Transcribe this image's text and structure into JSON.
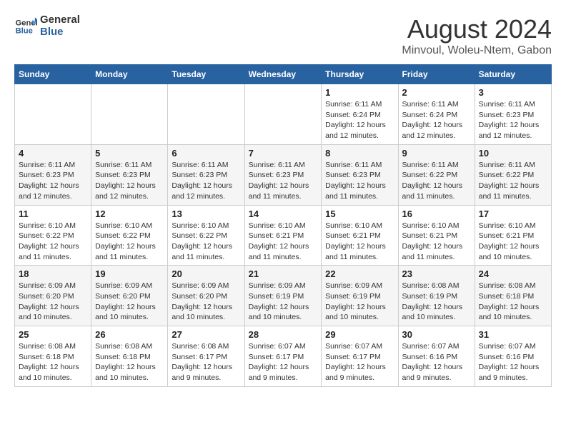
{
  "logo": {
    "line1": "General",
    "line2": "Blue"
  },
  "title": "August 2024",
  "location": "Minvoul, Woleu-Ntem, Gabon",
  "weekdays": [
    "Sunday",
    "Monday",
    "Tuesday",
    "Wednesday",
    "Thursday",
    "Friday",
    "Saturday"
  ],
  "weeks": [
    [
      {
        "day": "",
        "info": ""
      },
      {
        "day": "",
        "info": ""
      },
      {
        "day": "",
        "info": ""
      },
      {
        "day": "",
        "info": ""
      },
      {
        "day": "1",
        "info": "Sunrise: 6:11 AM\nSunset: 6:24 PM\nDaylight: 12 hours\nand 12 minutes."
      },
      {
        "day": "2",
        "info": "Sunrise: 6:11 AM\nSunset: 6:24 PM\nDaylight: 12 hours\nand 12 minutes."
      },
      {
        "day": "3",
        "info": "Sunrise: 6:11 AM\nSunset: 6:23 PM\nDaylight: 12 hours\nand 12 minutes."
      }
    ],
    [
      {
        "day": "4",
        "info": "Sunrise: 6:11 AM\nSunset: 6:23 PM\nDaylight: 12 hours\nand 12 minutes."
      },
      {
        "day": "5",
        "info": "Sunrise: 6:11 AM\nSunset: 6:23 PM\nDaylight: 12 hours\nand 12 minutes."
      },
      {
        "day": "6",
        "info": "Sunrise: 6:11 AM\nSunset: 6:23 PM\nDaylight: 12 hours\nand 12 minutes."
      },
      {
        "day": "7",
        "info": "Sunrise: 6:11 AM\nSunset: 6:23 PM\nDaylight: 12 hours\nand 11 minutes."
      },
      {
        "day": "8",
        "info": "Sunrise: 6:11 AM\nSunset: 6:23 PM\nDaylight: 12 hours\nand 11 minutes."
      },
      {
        "day": "9",
        "info": "Sunrise: 6:11 AM\nSunset: 6:22 PM\nDaylight: 12 hours\nand 11 minutes."
      },
      {
        "day": "10",
        "info": "Sunrise: 6:11 AM\nSunset: 6:22 PM\nDaylight: 12 hours\nand 11 minutes."
      }
    ],
    [
      {
        "day": "11",
        "info": "Sunrise: 6:10 AM\nSunset: 6:22 PM\nDaylight: 12 hours\nand 11 minutes."
      },
      {
        "day": "12",
        "info": "Sunrise: 6:10 AM\nSunset: 6:22 PM\nDaylight: 12 hours\nand 11 minutes."
      },
      {
        "day": "13",
        "info": "Sunrise: 6:10 AM\nSunset: 6:22 PM\nDaylight: 12 hours\nand 11 minutes."
      },
      {
        "day": "14",
        "info": "Sunrise: 6:10 AM\nSunset: 6:21 PM\nDaylight: 12 hours\nand 11 minutes."
      },
      {
        "day": "15",
        "info": "Sunrise: 6:10 AM\nSunset: 6:21 PM\nDaylight: 12 hours\nand 11 minutes."
      },
      {
        "day": "16",
        "info": "Sunrise: 6:10 AM\nSunset: 6:21 PM\nDaylight: 12 hours\nand 11 minutes."
      },
      {
        "day": "17",
        "info": "Sunrise: 6:10 AM\nSunset: 6:21 PM\nDaylight: 12 hours\nand 10 minutes."
      }
    ],
    [
      {
        "day": "18",
        "info": "Sunrise: 6:09 AM\nSunset: 6:20 PM\nDaylight: 12 hours\nand 10 minutes."
      },
      {
        "day": "19",
        "info": "Sunrise: 6:09 AM\nSunset: 6:20 PM\nDaylight: 12 hours\nand 10 minutes."
      },
      {
        "day": "20",
        "info": "Sunrise: 6:09 AM\nSunset: 6:20 PM\nDaylight: 12 hours\nand 10 minutes."
      },
      {
        "day": "21",
        "info": "Sunrise: 6:09 AM\nSunset: 6:19 PM\nDaylight: 12 hours\nand 10 minutes."
      },
      {
        "day": "22",
        "info": "Sunrise: 6:09 AM\nSunset: 6:19 PM\nDaylight: 12 hours\nand 10 minutes."
      },
      {
        "day": "23",
        "info": "Sunrise: 6:08 AM\nSunset: 6:19 PM\nDaylight: 12 hours\nand 10 minutes."
      },
      {
        "day": "24",
        "info": "Sunrise: 6:08 AM\nSunset: 6:18 PM\nDaylight: 12 hours\nand 10 minutes."
      }
    ],
    [
      {
        "day": "25",
        "info": "Sunrise: 6:08 AM\nSunset: 6:18 PM\nDaylight: 12 hours\nand 10 minutes."
      },
      {
        "day": "26",
        "info": "Sunrise: 6:08 AM\nSunset: 6:18 PM\nDaylight: 12 hours\nand 10 minutes."
      },
      {
        "day": "27",
        "info": "Sunrise: 6:08 AM\nSunset: 6:17 PM\nDaylight: 12 hours\nand 9 minutes."
      },
      {
        "day": "28",
        "info": "Sunrise: 6:07 AM\nSunset: 6:17 PM\nDaylight: 12 hours\nand 9 minutes."
      },
      {
        "day": "29",
        "info": "Sunrise: 6:07 AM\nSunset: 6:17 PM\nDaylight: 12 hours\nand 9 minutes."
      },
      {
        "day": "30",
        "info": "Sunrise: 6:07 AM\nSunset: 6:16 PM\nDaylight: 12 hours\nand 9 minutes."
      },
      {
        "day": "31",
        "info": "Sunrise: 6:07 AM\nSunset: 6:16 PM\nDaylight: 12 hours\nand 9 minutes."
      }
    ]
  ]
}
